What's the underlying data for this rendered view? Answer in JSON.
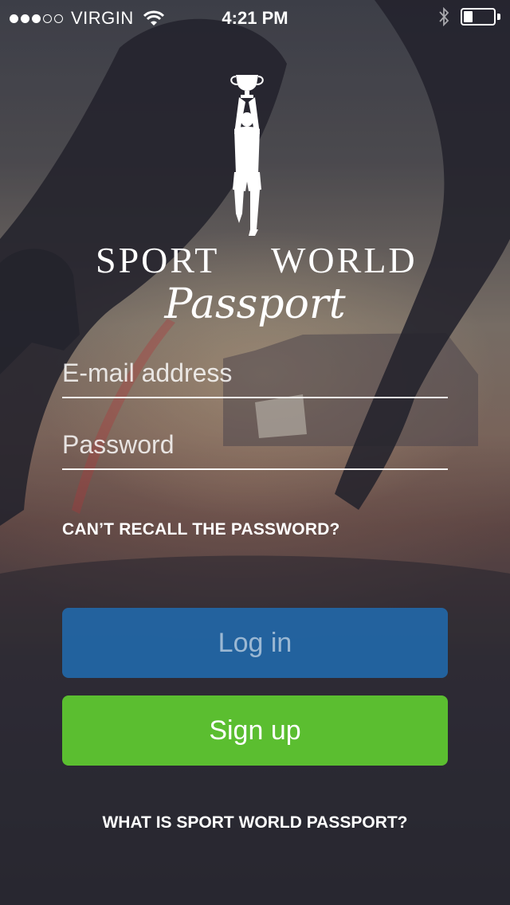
{
  "status_bar": {
    "carrier": "VIRGIN",
    "time": "4:21 PM",
    "signal_bars_filled": 3,
    "signal_bars_total": 5,
    "battery_level": 0.3
  },
  "logo": {
    "word_left": "SPORT",
    "word_right": "WORLD",
    "script": "Passport"
  },
  "form": {
    "email_placeholder": "E-mail address",
    "email_value": "",
    "password_placeholder": "Password",
    "password_value": "",
    "forgot_label": "CAN’T RECALL THE PASSWORD?"
  },
  "buttons": {
    "login_label": "Log in",
    "signup_label": "Sign up"
  },
  "footer": {
    "about_label": "WHAT IS SPORT WORLD PASSPORT?"
  },
  "colors": {
    "login_button": "#2168aa",
    "signup_button": "#5bbe30",
    "text": "#ffffff"
  },
  "icons": [
    "wifi-icon",
    "bluetooth-icon",
    "battery-icon",
    "trophy-figure-icon"
  ]
}
